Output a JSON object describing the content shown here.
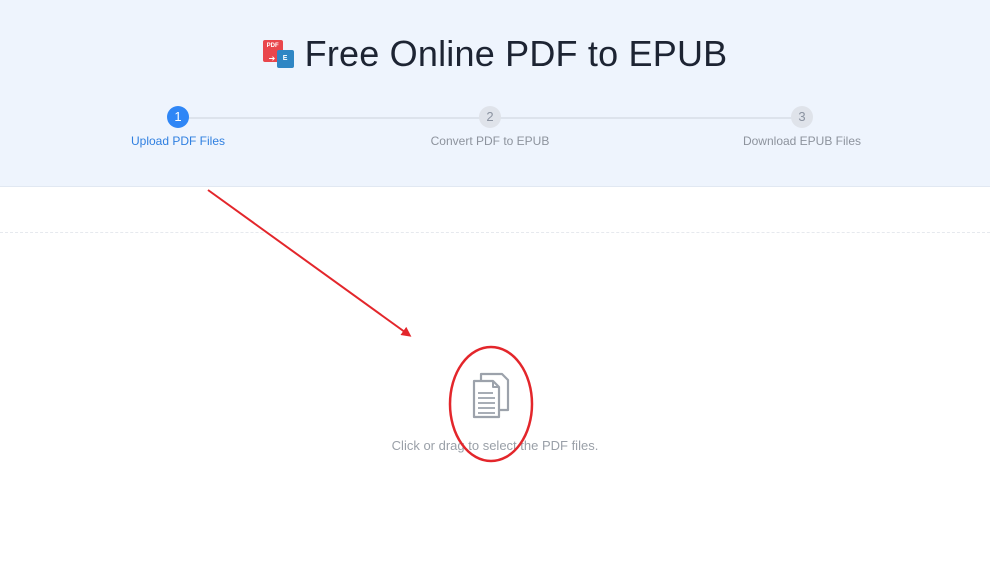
{
  "header": {
    "title": "Free Online PDF to EPUB",
    "logo": {
      "icon": "pdf-to-epub-logo-icon",
      "pdf_text": "PDF",
      "epub_text": "E",
      "pdf_color": "#e9464c",
      "epub_color": "#2f86c4"
    }
  },
  "steps": [
    {
      "number": "1",
      "label": "Upload PDF Files",
      "active": true
    },
    {
      "number": "2",
      "label": "Convert PDF to EPUB",
      "active": false
    },
    {
      "number": "3",
      "label": "Download EPUB Files",
      "active": false
    }
  ],
  "upload": {
    "icon": "document-icon",
    "text": "Click or drag to select the PDF files."
  },
  "colors": {
    "accent": "#2f86f6",
    "header_bg": "#eef4fd",
    "annotation": "#e3262b"
  }
}
